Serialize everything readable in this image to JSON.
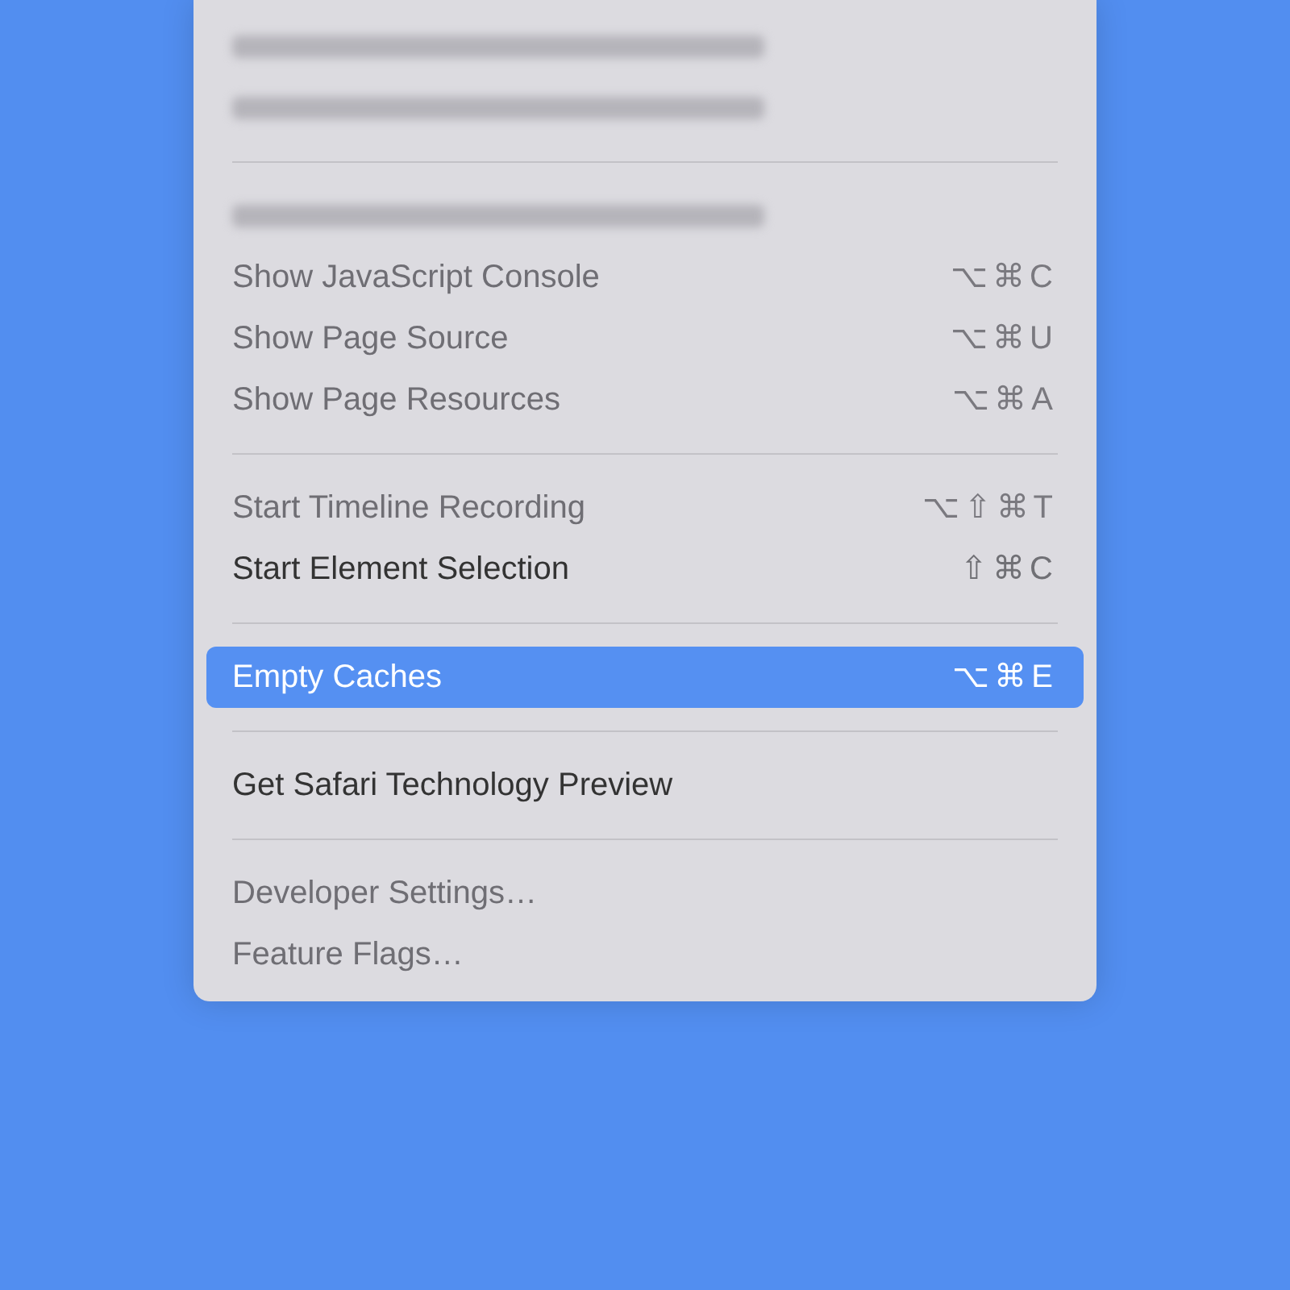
{
  "menu": {
    "items": [
      {
        "kind": "obscured"
      },
      {
        "kind": "obscured"
      },
      {
        "kind": "separator"
      },
      {
        "kind": "obscured"
      },
      {
        "kind": "item",
        "label": "Show JavaScript Console",
        "shortcut": "⌥⌘C",
        "dimmed": true,
        "selected": false
      },
      {
        "kind": "item",
        "label": "Show Page Source",
        "shortcut": "⌥⌘U",
        "dimmed": true,
        "selected": false
      },
      {
        "kind": "item",
        "label": "Show Page Resources",
        "shortcut": "⌥⌘A",
        "dimmed": true,
        "selected": false
      },
      {
        "kind": "separator"
      },
      {
        "kind": "item",
        "label": "Start Timeline Recording",
        "shortcut": "⌥⇧⌘T",
        "dimmed": true,
        "selected": false
      },
      {
        "kind": "item",
        "label": "Start Element Selection",
        "shortcut": "⇧⌘C",
        "dimmed": false,
        "selected": false
      },
      {
        "kind": "separator"
      },
      {
        "kind": "item",
        "label": "Empty Caches",
        "shortcut": "⌥⌘E",
        "selected": true
      },
      {
        "kind": "separator"
      },
      {
        "kind": "item",
        "label": "Get Safari Technology Preview",
        "dimmed": false,
        "selected": false
      },
      {
        "kind": "separator"
      },
      {
        "kind": "item",
        "label": "Developer Settings…",
        "dimmed": true,
        "selected": false
      },
      {
        "kind": "item",
        "label": "Feature Flags…",
        "dimmed": true,
        "selected": false
      }
    ]
  }
}
